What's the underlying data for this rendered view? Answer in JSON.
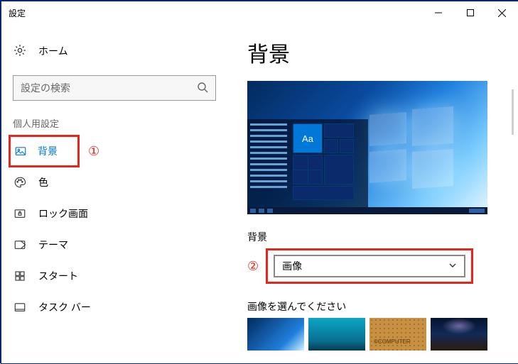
{
  "window": {
    "title": "設定"
  },
  "sidebar": {
    "home": "ホーム",
    "search_placeholder": "設定の検索",
    "section": "個人用設定",
    "items": [
      {
        "label": "背景"
      },
      {
        "label": "色"
      },
      {
        "label": "ロック画面"
      },
      {
        "label": "テーマ"
      },
      {
        "label": "スタート"
      },
      {
        "label": "タスク バー"
      }
    ]
  },
  "main": {
    "heading": "背景",
    "preview_tile_text": "Aa",
    "bg_label": "背景",
    "bg_dropdown_value": "画像",
    "choose_label": "画像を選んでください"
  },
  "annotations": {
    "one": "①",
    "two": "②"
  }
}
